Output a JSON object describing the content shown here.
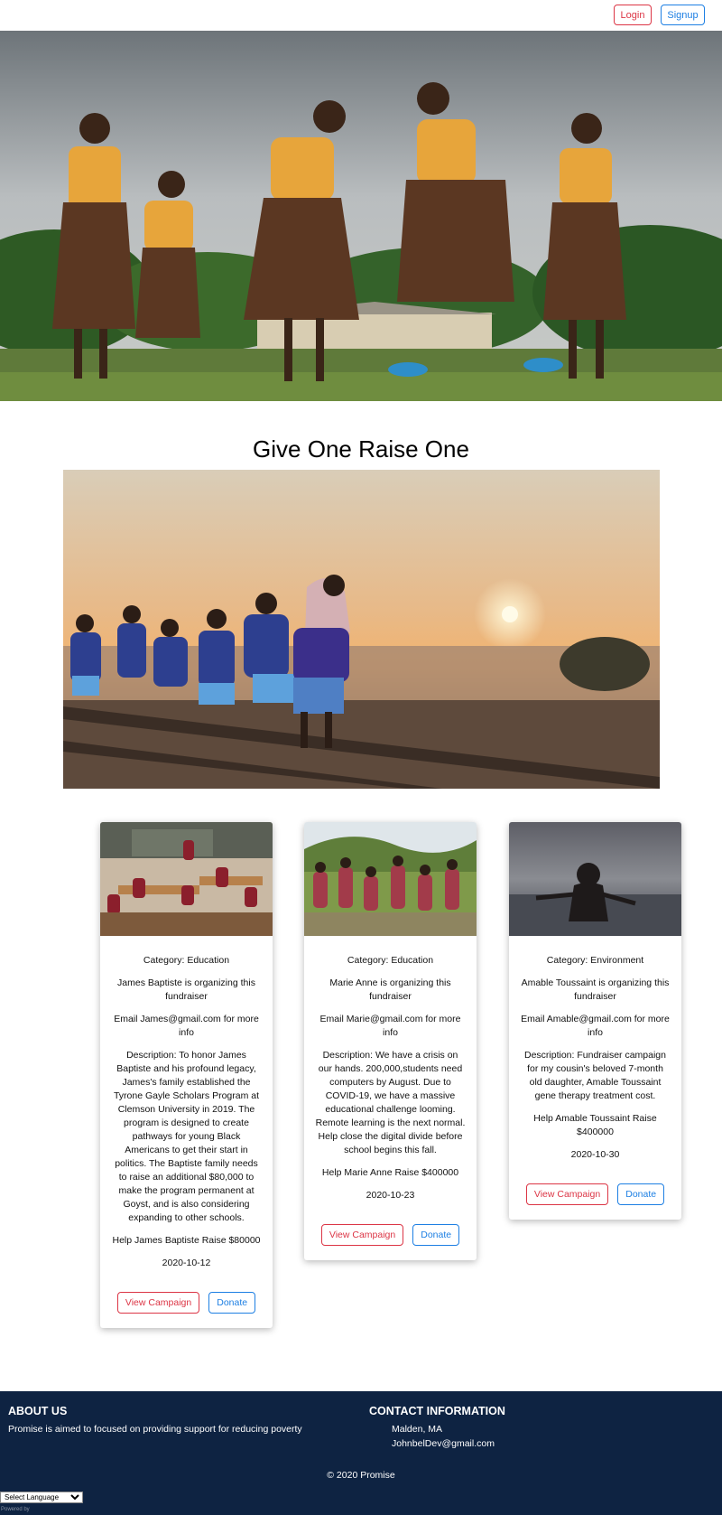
{
  "nav": {
    "login_label": "Login",
    "signup_label": "Signup"
  },
  "main": {
    "title": "Give One Raise One"
  },
  "cards": [
    {
      "category": "Category: Education",
      "organizer": "James Baptiste is organizing this fundraiser",
      "email": "Email James@gmail.com for more info",
      "description": "Description: To honor James Baptiste and his profound legacy, James's family established the Tyrone Gayle Scholars Program at Clemson University in 2019. The program is designed to create pathways for young Black Americans to get their start in politics. The Baptiste family needs to raise an additional $80,000 to make the program permanent at Goyst, and is also considering expanding to other schools.",
      "goal": "Help James Baptiste Raise $80000",
      "date": "2020-10-12",
      "view_label": "View Campaign",
      "donate_label": "Donate"
    },
    {
      "category": "Category: Education",
      "organizer": "Marie Anne is organizing this fundraiser",
      "email": "Email Marie@gmail.com for more info",
      "description": "Description: We have a crisis on our hands. 200,000,students need computers by August. Due to COVID-19, we have a massive educational challenge looming. Remote learning is the next normal. Help close the digital divide before school begins this fall.",
      "goal": "Help Marie Anne Raise $400000",
      "date": "2020-10-23",
      "view_label": "View Campaign",
      "donate_label": "Donate"
    },
    {
      "category": "Category: Environment",
      "organizer": "Amable Toussaint is organizing this fundraiser",
      "email": "Email Amable@gmail.com for more info",
      "description": "Description: Fundraiser campaign for my cousin's beloved 7-month old daughter, Amable Toussaint gene therapy treatment cost.",
      "goal": "Help Amable Toussaint Raise $400000",
      "date": "2020-10-30",
      "view_label": "View Campaign",
      "donate_label": "Donate"
    }
  ],
  "footer": {
    "about_title": "ABOUT US",
    "about_text": "Promise is aimed to focused on providing support for reducing poverty",
    "contact_title": "CONTACT INFORMATION",
    "contact_location": "Malden, MA",
    "contact_email": "JohnbelDev@gmail.com",
    "copyright": "© 2020 Promise",
    "language_select": "Select Language",
    "powered_by": "Powered by"
  },
  "colors": {
    "footer_bg": "#0e2342",
    "danger": "#dc3545",
    "primary": "#1d7fe3"
  }
}
